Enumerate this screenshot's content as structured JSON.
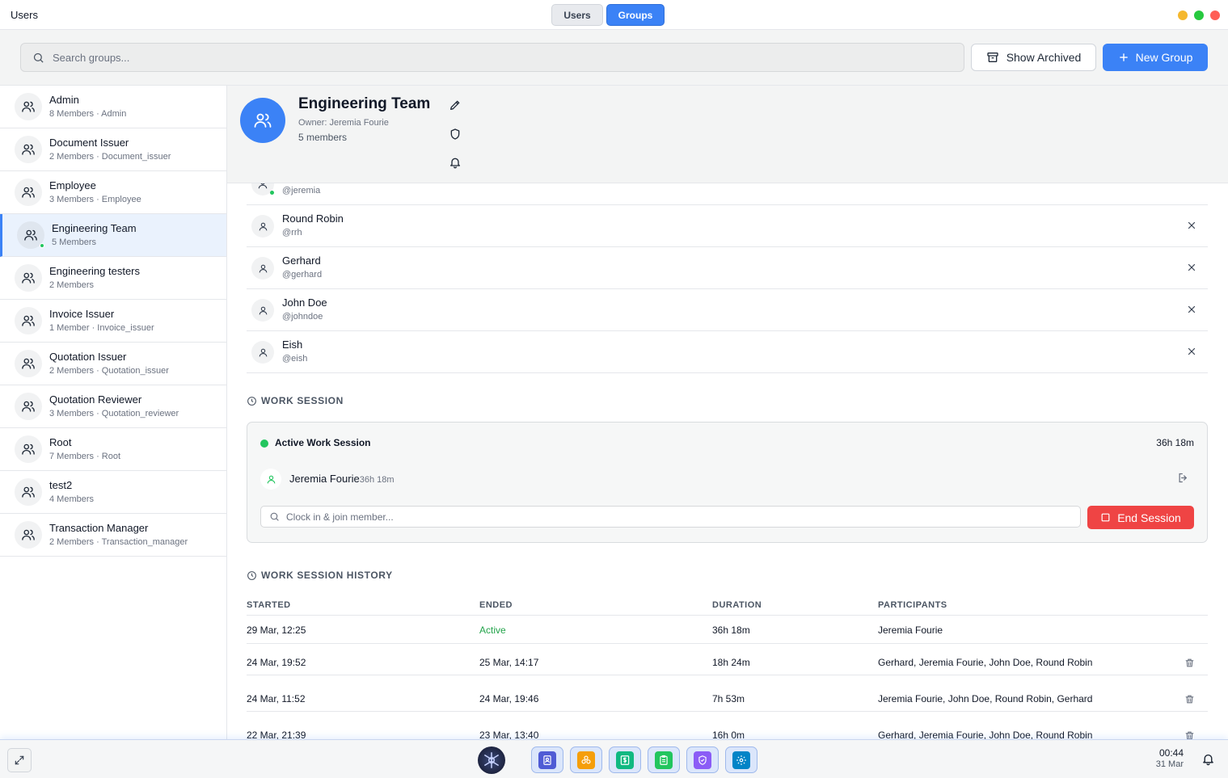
{
  "window": {
    "title": "Users",
    "tabs": [
      "Users",
      "Groups"
    ],
    "active_tab": "Groups",
    "traffic_colors": [
      "#f5b82e",
      "#27c93f",
      "#ff5f56"
    ]
  },
  "toolbar": {
    "search_placeholder": "Search groups...",
    "show_archived_label": "Show Archived",
    "new_group_label": "New Group"
  },
  "groups": [
    {
      "name": "Admin",
      "sub": "8 Members · Admin"
    },
    {
      "name": "Document Issuer",
      "sub": "2 Members · Document_issuer"
    },
    {
      "name": "Employee",
      "sub": "3 Members · Employee"
    },
    {
      "name": "Engineering Team",
      "sub": "5 Members"
    },
    {
      "name": "Engineering testers",
      "sub": "2 Members"
    },
    {
      "name": "Invoice Issuer",
      "sub": "1 Member · Invoice_issuer"
    },
    {
      "name": "Quotation Issuer",
      "sub": "2 Members · Quotation_issuer"
    },
    {
      "name": "Quotation Reviewer",
      "sub": "3 Members · Quotation_reviewer"
    },
    {
      "name": "Root",
      "sub": "7 Members · Root"
    },
    {
      "name": "test2",
      "sub": "4 Members"
    },
    {
      "name": "Transaction Manager",
      "sub": "2 Members · Transaction_manager"
    }
  ],
  "selected_group": {
    "name": "Engineering Team",
    "owner": "Owner: Jeremia Fourie",
    "member_count": "5 members"
  },
  "members": {
    "partial_username": "@jeremia",
    "rows": [
      {
        "name": "Round Robin",
        "username": "@rrh"
      },
      {
        "name": "Gerhard",
        "username": "@gerhard"
      },
      {
        "name": "John Doe",
        "username": "@johndoe"
      },
      {
        "name": "Eish",
        "username": "@eish"
      }
    ]
  },
  "work_session": {
    "section_title": "WORK SESSION",
    "card_title": "Active Work Session",
    "duration": "36h 18m",
    "participant_name": "Jeremia Fourie",
    "participant_time": "36h 18m",
    "join_placeholder": "Clock in & join member...",
    "end_label": "End Session"
  },
  "history": {
    "section_title": "WORK SESSION HISTORY",
    "columns": [
      "STARTED",
      "ENDED",
      "DURATION",
      "PARTICIPANTS"
    ],
    "rows": [
      {
        "started": "29 Mar, 12:25",
        "ended": "Active",
        "duration": "36h 18m",
        "participants": "Jeremia Fourie"
      },
      {
        "started": "24 Mar, 19:52",
        "ended": "25 Mar, 14:17",
        "duration": "18h 24m",
        "participants": "Gerhard, Jeremia Fourie, John Doe, Round Robin"
      },
      {
        "started": "24 Mar, 11:52",
        "ended": "24 Mar, 19:46",
        "duration": "7h 53m",
        "participants": "Jeremia Fourie, John Doe, Round Robin, Gerhard"
      },
      {
        "started": "22 Mar, 21:39",
        "ended": "23 Mar, 13:40",
        "duration": "16h 0m",
        "participants": "Gerhard, Jeremia Fourie, John Doe, Round Robin"
      }
    ]
  },
  "taskbar": {
    "time": "00:44",
    "date": "31 Mar",
    "apps": [
      {
        "icon": "contacts-icon",
        "color": "#4f5bd5"
      },
      {
        "icon": "modules-icon",
        "color": "#f59e0b"
      },
      {
        "icon": "finance-icon",
        "color": "#10b981"
      },
      {
        "icon": "clipboard-icon",
        "color": "#22c55e"
      },
      {
        "icon": "shield-icon",
        "color": "#8b5cf6"
      },
      {
        "icon": "settings-icon",
        "color": "#0284c7"
      }
    ]
  }
}
